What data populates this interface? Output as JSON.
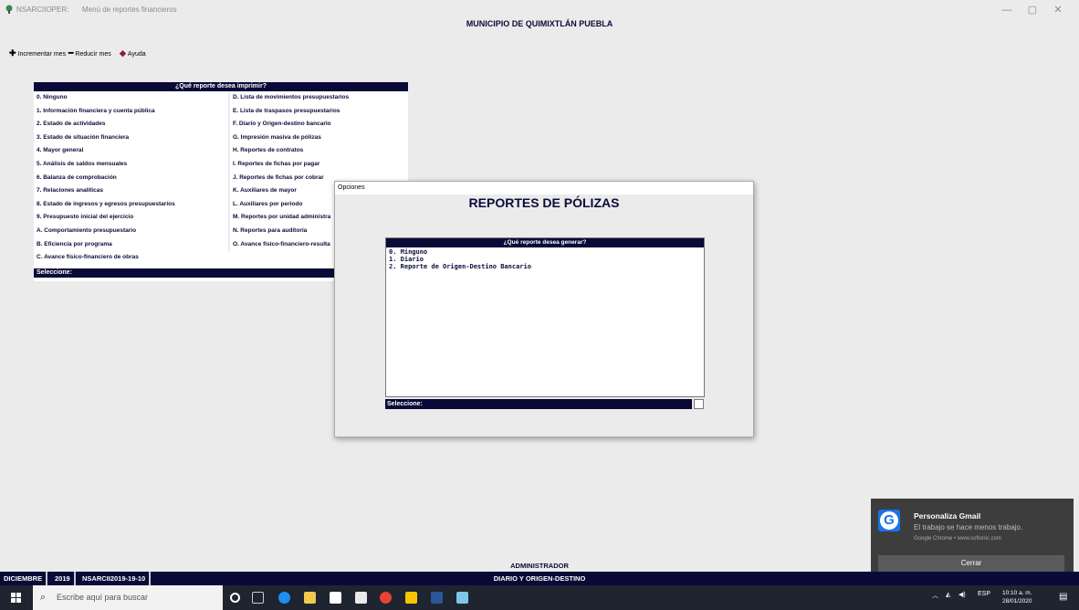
{
  "titlebar": {
    "app_name": "NSARCIIOPER:",
    "window_title": "Menú de reportes financieros",
    "minimize": "—",
    "maximize": "▢",
    "close": "✕"
  },
  "header": {
    "municipio": "MUNICIPIO DE QUIMIXTLÁN PUEBLA"
  },
  "toolbar": {
    "increase_label": "Incrementar mes",
    "decrease_label": "Reducir mes",
    "help_label": "Ayuda"
  },
  "menu": {
    "title": "¿Qué reporte desea imprimir?",
    "left_items": [
      "0. Ninguno",
      "1. Información financiera y cuenta pública",
      "2. Estado de actividades",
      "3. Estado de situación financiera",
      "4. Mayor general",
      "5. Análisis de saldos mensuales",
      "6. Balanza de comprobación",
      "7. Relaciones analíticas",
      "8. Estado de ingresos y egresos presupuestarios",
      "9. Presupuesto inicial del ejercicio",
      "A. Comportamiento presupuestario",
      "B. Eficiencia por programa",
      "C. Avance físico-financiero de obras"
    ],
    "right_items": [
      "D. Lista de movimientos presupuestarios",
      "E. Lista de traspasos presupuestarios",
      "F. Diario y Origen-destino bancario",
      "G. Impresión masiva de pólizas",
      "H. Reportes de contratos",
      "I. Reportes de fichas por pagar",
      "J. Reportes de fichas por cobrar",
      "K. Auxiliares de mayor",
      "L. Auxiliares por periodo",
      "M. Reportes por unidad administra",
      "N. Reportes para auditoría",
      "O. Avance físico-financiero-resulta"
    ],
    "select_label": "Seleccione:"
  },
  "dialog": {
    "window_title": "Opciones",
    "heading": "REPORTES DE PÓLIZAS",
    "list_title": "¿Qué reporte desea generar?",
    "items": [
      "0. Minguno",
      "1. Diario",
      "2. Reporte de Origen-Destino Bancario"
    ],
    "select_label": "Seleccione:",
    "input_value": ""
  },
  "notification": {
    "title": "Personaliza Gmail",
    "body": "El trabajo se hace menos trabajo.",
    "source": "Google Chrome • www.softonic.com",
    "button": "Cerrar"
  },
  "status": {
    "user": "ADMINISTRADOR",
    "month": "DICIEMBRE",
    "year": "2019",
    "code": "NSARCII2019-19-10",
    "current_report": "DIARIO Y ORIGEN-DESTINO"
  },
  "taskbar": {
    "search_placeholder": "Escribe aquí para buscar",
    "language": "ESP",
    "time": "10:10 a. m.",
    "date": "28/01/2020"
  },
  "colors": {
    "navy": "#0a0a38",
    "background": "#ebebeb",
    "taskbar": "#1e2430",
    "toast": "#3d3d3d"
  }
}
